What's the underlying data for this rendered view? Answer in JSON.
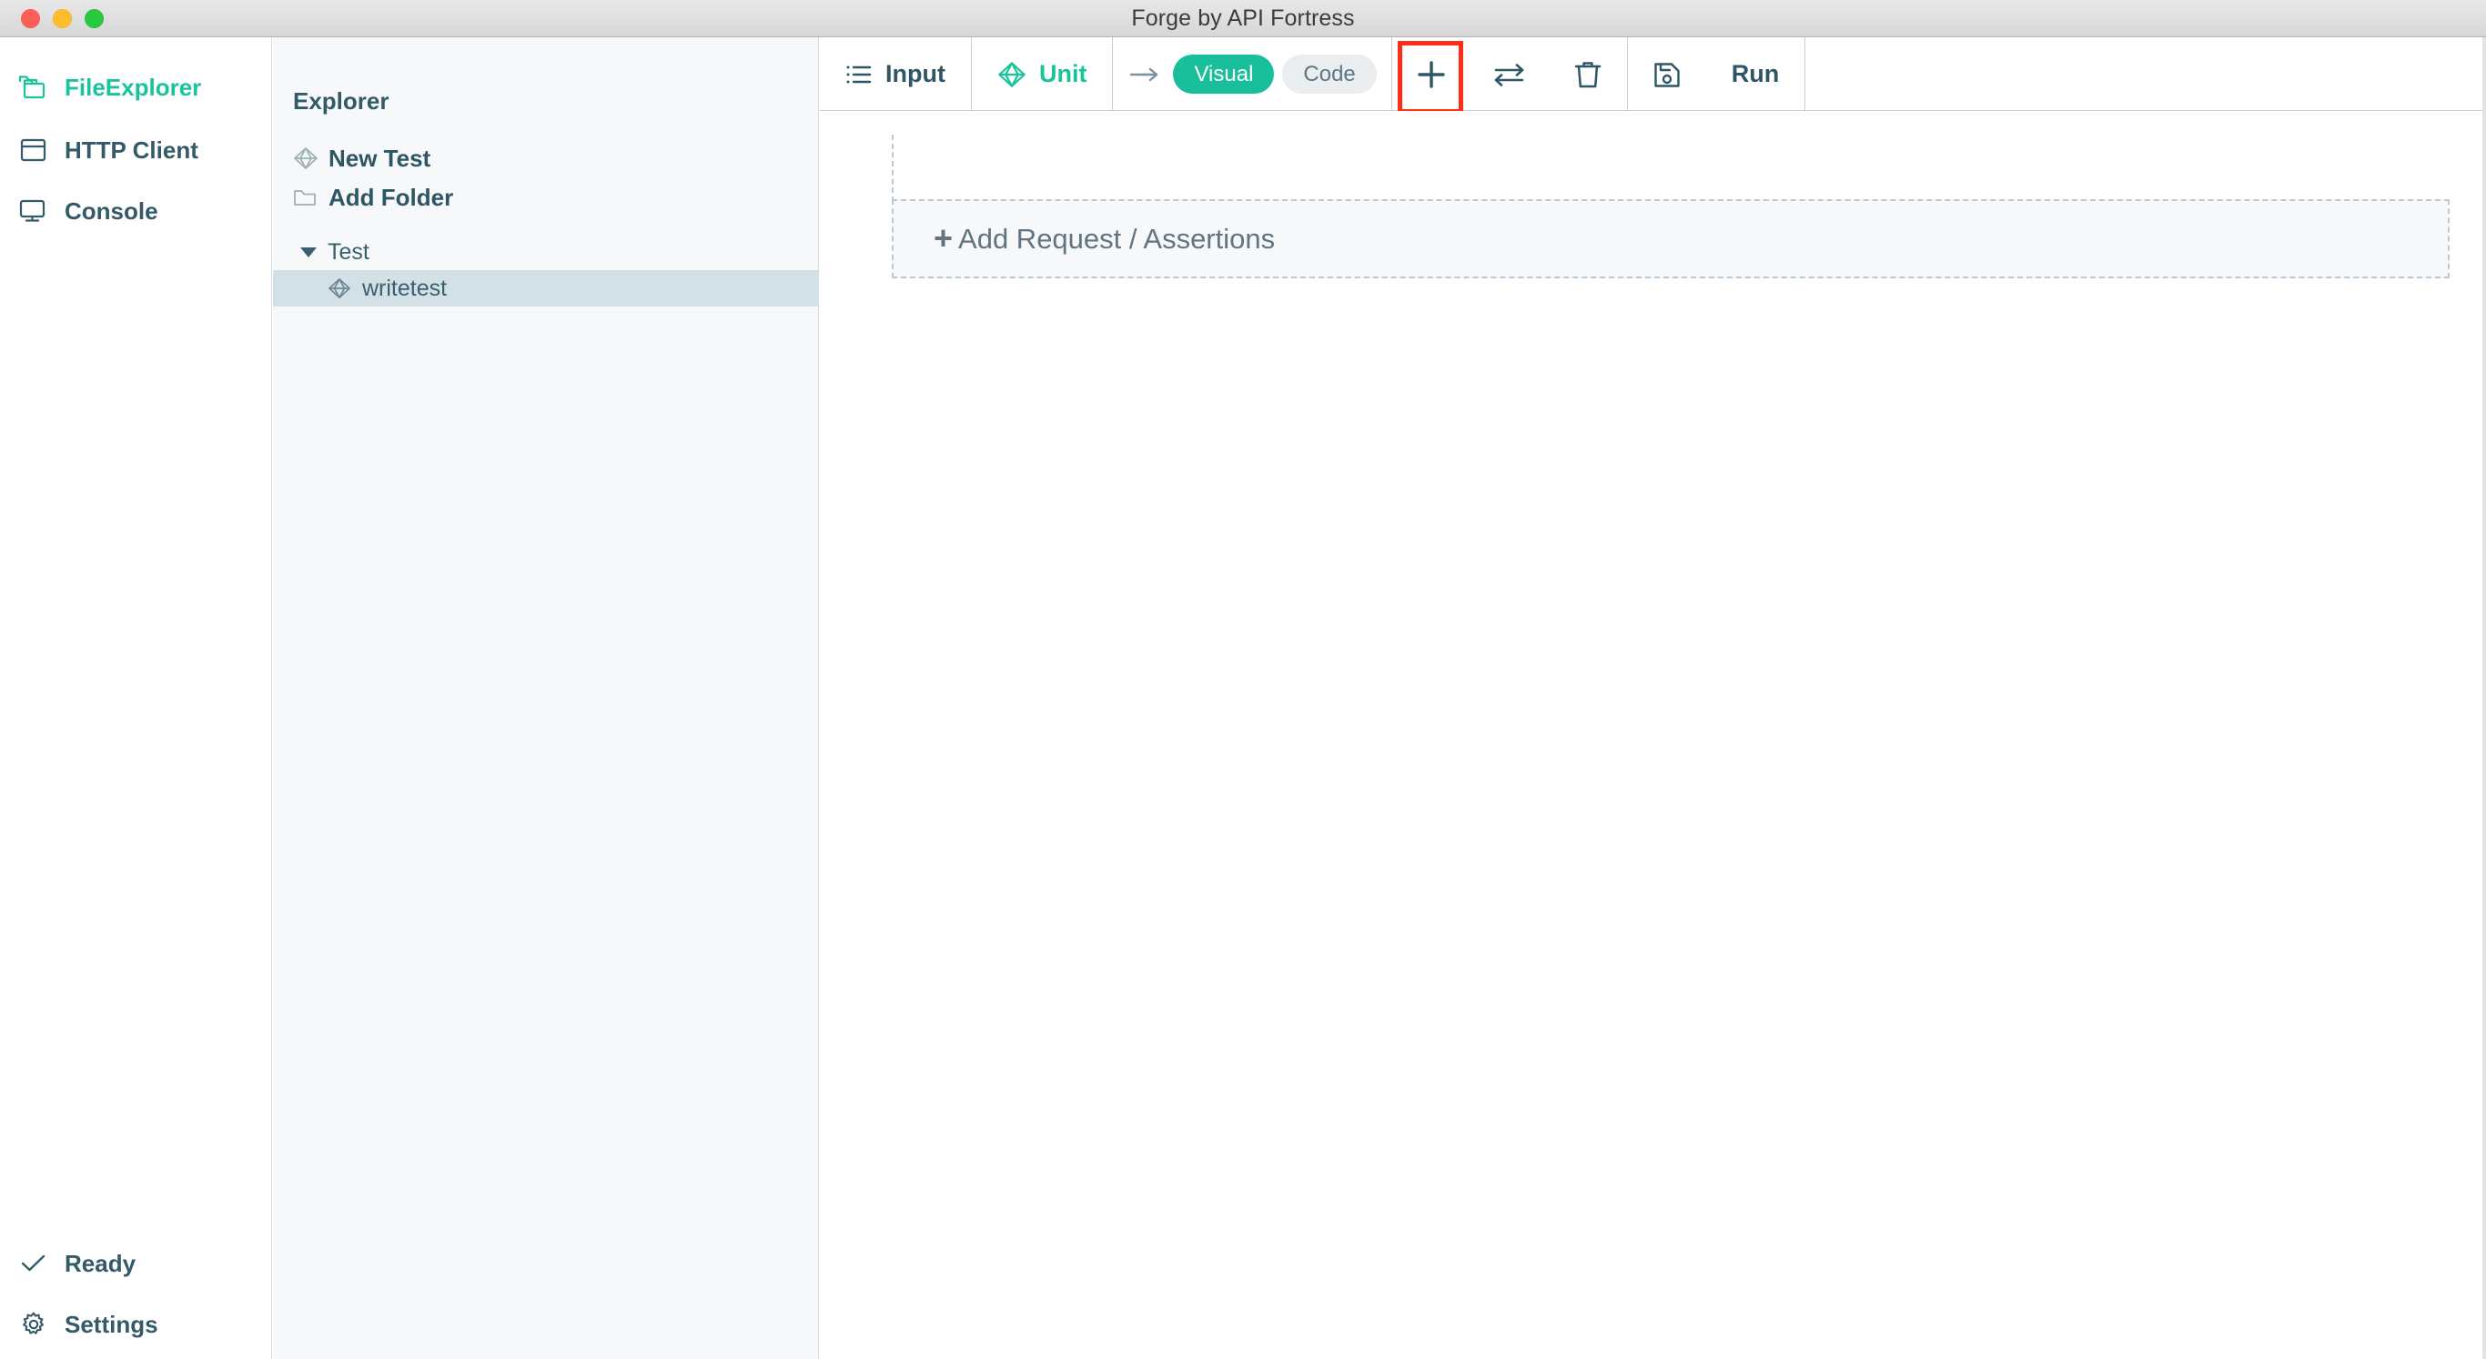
{
  "window": {
    "title": "Forge by API Fortress",
    "controls": [
      {
        "name": "close",
        "color": "#ff5f57"
      },
      {
        "name": "minimize",
        "color": "#ffbd2e"
      },
      {
        "name": "maximize",
        "color": "#28c840"
      }
    ]
  },
  "colors": {
    "accent": "#19c39c",
    "toggle_on": "#18bf9a",
    "text_primary": "#2e5665",
    "text_muted": "#60757f",
    "selection": "#d3e0e6",
    "highlight_box": "#ff2d16",
    "panel_bg": "#f7f8f9",
    "border": "#c3d0d8"
  },
  "nav_rail": {
    "items": [
      {
        "icon": "folders-icon",
        "label": "FileExplorer",
        "active": true
      },
      {
        "icon": "browser-window-icon",
        "label": "HTTP Client",
        "active": false
      },
      {
        "icon": "monitor-icon",
        "label": "Console",
        "active": false
      }
    ],
    "footer": [
      {
        "icon": "check-icon",
        "label": "Ready"
      },
      {
        "icon": "gear-icon",
        "label": "Settings"
      }
    ]
  },
  "explorer": {
    "title": "Explorer",
    "actions": [
      {
        "icon": "cube-icon",
        "label": "New Test"
      },
      {
        "icon": "folder-icon",
        "label": "Add Folder"
      }
    ],
    "tree": [
      {
        "type": "folder",
        "label": "Test",
        "expanded": true,
        "selected": false
      },
      {
        "type": "test",
        "label": "writetest",
        "selected": true
      }
    ]
  },
  "toolbar": {
    "input_label": "Input",
    "unit_label": "Unit",
    "mode_toggle": {
      "options": [
        "Visual",
        "Code"
      ],
      "selected": "Visual"
    },
    "add_label": "+",
    "swap_icon": "swap-arrows-icon",
    "delete_icon": "trash-icon",
    "save_icon": "save-disk-icon",
    "run_label": "Run",
    "highlighted_button": "add-button"
  },
  "canvas": {
    "add_request_plus": "+",
    "add_request_label": "Add Request / Assertions"
  }
}
